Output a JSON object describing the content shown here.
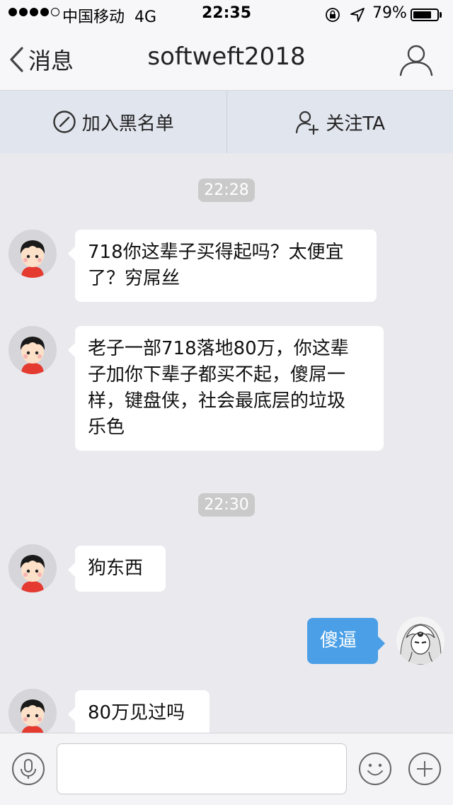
{
  "status_bar": {
    "carrier": "中国移动",
    "network": "4G",
    "time": "22:35",
    "battery_percent": "79%",
    "battery_level": 0.79,
    "signal_strength_dots": 4
  },
  "nav": {
    "back_label": "消息",
    "title": "softweft2018",
    "profile_icon": "person-icon"
  },
  "actions": {
    "blacklist_label": "加入黑名单",
    "blacklist_icon": "block-icon",
    "follow_label": "关注TA",
    "follow_icon": "add-person-icon"
  },
  "chat": {
    "timestamps": [
      "22:28",
      "22:30"
    ],
    "messages": [
      {
        "direction": "in",
        "lines": [
          "718你这辈子买得起吗？太便宜",
          "了？穷屌丝"
        ]
      },
      {
        "direction": "in",
        "lines": [
          "老子一部718落地80万，你这辈",
          "子加你下辈子都买不起，傻屌一",
          "样，键盘侠，社会最底层的垃圾",
          "乐色"
        ]
      },
      {
        "direction": "in",
        "lines": [
          "狗东西"
        ]
      },
      {
        "direction": "out",
        "lines": [
          "傻逼"
        ]
      },
      {
        "direction": "in",
        "lines": [
          "80万见过吗"
        ]
      }
    ]
  },
  "input_bar": {
    "placeholder": "",
    "voice_icon": "microphone-icon",
    "emoji_icon": "smiley-icon",
    "more_icon": "plus-icon"
  },
  "colors": {
    "outgoing_bubble": "#4a9fe7",
    "incoming_bubble": "#ffffff",
    "background": "#e9e9ee",
    "action_bar": "#e1e5ee"
  }
}
